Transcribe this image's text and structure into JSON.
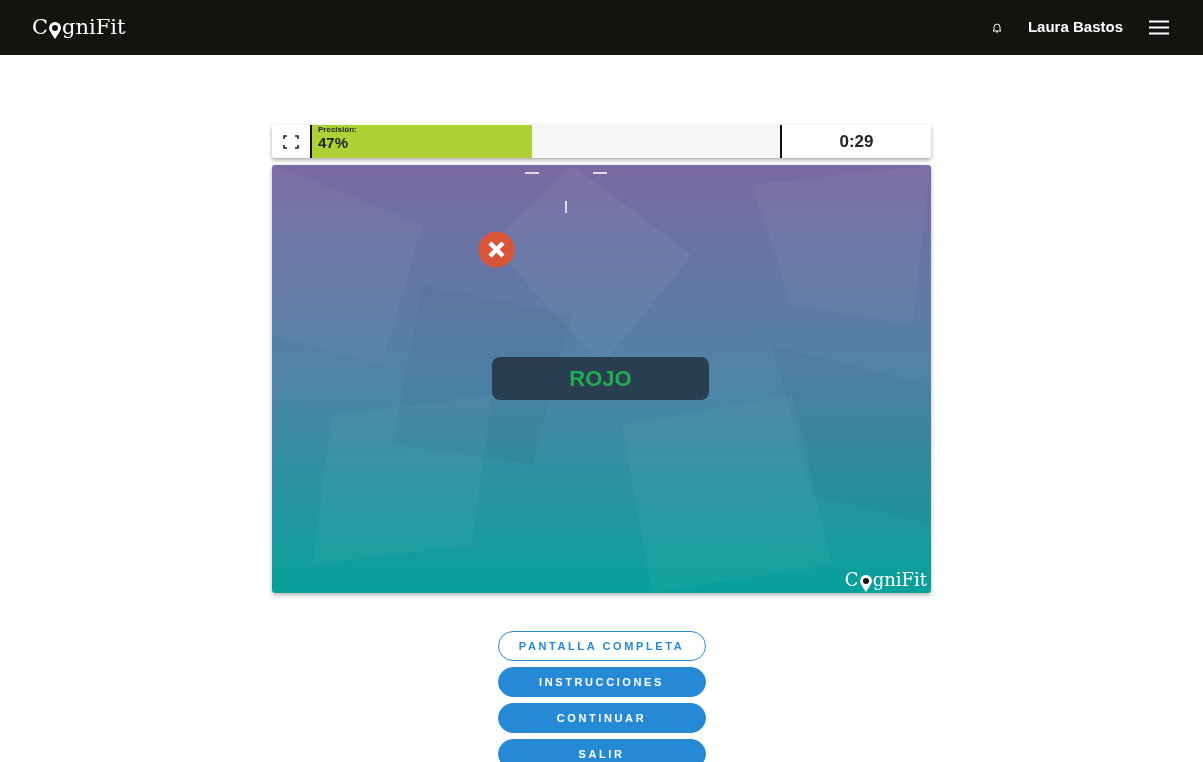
{
  "navbar": {
    "logo": {
      "before": "C",
      "after": "gniFit"
    },
    "user_name": "Laura Bastos"
  },
  "game": {
    "accuracy": {
      "label": "Precisión:",
      "value": "47%",
      "level": 0.47
    },
    "timer": "0:29",
    "feedback": {
      "kind": "wrong"
    },
    "word": {
      "text": "ROJO",
      "color": "#1fae4b"
    },
    "watermark": {
      "before": "C",
      "after": "gniFit"
    }
  },
  "buttons": [
    {
      "label": "PANTALLA COMPLETA",
      "kind": "outline"
    },
    {
      "label": "INSTRUCCIONES",
      "kind": "filled"
    },
    {
      "label": "CONTINUAR",
      "kind": "filled"
    },
    {
      "label": "SALIR",
      "kind": "filled"
    }
  ]
}
